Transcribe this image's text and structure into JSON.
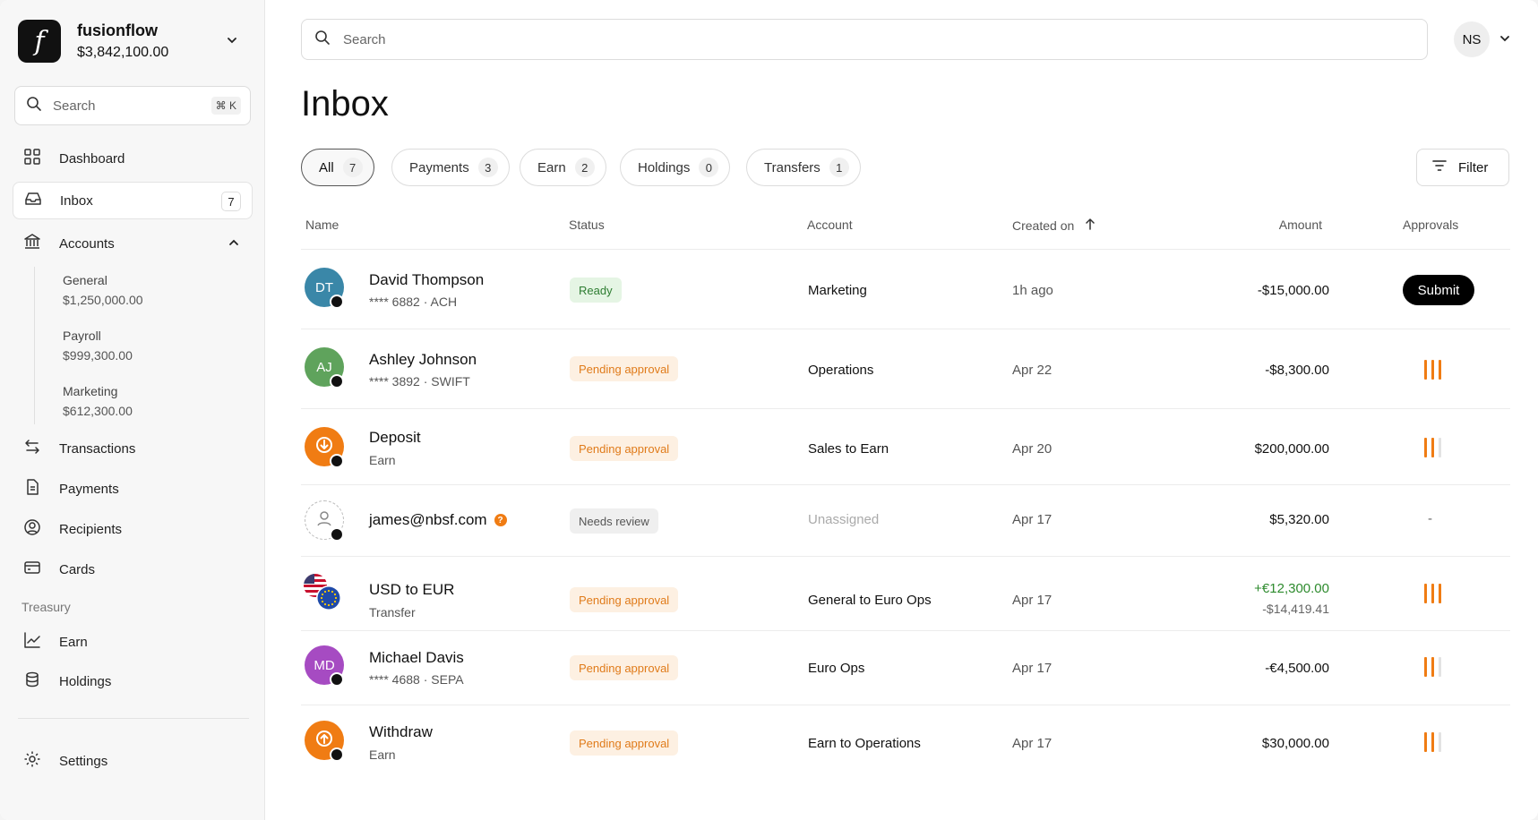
{
  "org": {
    "name": "fusionflow",
    "balance": "$3,842,100.00",
    "logo_letter": "f"
  },
  "sidebar": {
    "search_placeholder": "Search",
    "search_shortcut": "⌘ K",
    "nav": [
      {
        "label": "Dashboard",
        "icon": "grid-icon"
      },
      {
        "label": "Inbox",
        "icon": "inbox-icon",
        "count": "7",
        "active": true
      },
      {
        "label": "Accounts",
        "icon": "bank-icon",
        "expanded": true
      }
    ],
    "accounts": [
      {
        "name": "General",
        "balance": "$1,250,000.00"
      },
      {
        "name": "Payroll",
        "balance": "$999,300.00"
      },
      {
        "name": "Marketing",
        "balance": "$612,300.00"
      }
    ],
    "nav2": [
      {
        "label": "Transactions",
        "icon": "arrows-swap-icon"
      },
      {
        "label": "Payments",
        "icon": "document-icon"
      },
      {
        "label": "Recipients",
        "icon": "user-circle-icon"
      },
      {
        "label": "Cards",
        "icon": "credit-card-icon"
      }
    ],
    "treasury_label": "Treasury",
    "treasury": [
      {
        "label": "Earn",
        "icon": "chart-up-icon"
      },
      {
        "label": "Holdings",
        "icon": "database-icon"
      }
    ],
    "settings_label": "Settings"
  },
  "header": {
    "search_placeholder": "Search",
    "user_initials": "NS",
    "title": "Inbox"
  },
  "tabs": [
    {
      "label": "All",
      "count": "7",
      "active": true
    },
    {
      "label": "Payments",
      "count": "3"
    },
    {
      "label": "Earn",
      "count": "2"
    },
    {
      "label": "Holdings",
      "count": "0"
    },
    {
      "label": "Transfers",
      "count": "1"
    }
  ],
  "filter_label": "Filter",
  "columns": {
    "name": "Name",
    "status": "Status",
    "account": "Account",
    "created": "Created on",
    "amount": "Amount",
    "approvals": "Approvals"
  },
  "rows": [
    {
      "initials": "DT",
      "avatar_color": "#3a87a8",
      "name": "David Thompson",
      "detail": "**** 6882  ·  ACH",
      "status": "Ready",
      "account": "Marketing",
      "date": "1h ago",
      "amount": "-$15,000.00",
      "approval": "Submit"
    },
    {
      "initials": "AJ",
      "avatar_color": "#5fa35c",
      "name": "Ashley Johnson",
      "detail": "**** 3892  ·  SWIFT",
      "status": "Pending approval",
      "account": "Operations",
      "date": "Apr 22",
      "amount": "-$8,300.00",
      "approvals_done": 3,
      "approvals_total": 3
    },
    {
      "icon": "download-arrow-icon",
      "avatar_color": "#f07c13",
      "name": "Deposit",
      "detail": "Earn",
      "status": "Pending approval",
      "account": "Sales to Earn",
      "date": "Apr 20",
      "amount": "$200,000.00",
      "approvals_done": 2,
      "approvals_total": 3
    },
    {
      "icon": "person-outline-icon",
      "name": "james@nbsf.com",
      "status": "Needs review",
      "account": "Unassigned",
      "date": "Apr 17",
      "amount": "$5,320.00",
      "approval": "-"
    },
    {
      "icon": "flags-us-eu-icon",
      "name": "USD to EUR",
      "detail": "Transfer",
      "status": "Pending approval",
      "account": "General to Euro Ops",
      "date": "Apr 17",
      "amount": "+€12,300.00",
      "amount_sub": "-$14,419.41",
      "approvals_done": 3,
      "approvals_total": 3
    },
    {
      "initials": "MD",
      "avatar_color": "#a64bc2",
      "name": "Michael Davis",
      "detail": "**** 4688   ·   SEPA",
      "status": "Pending approval",
      "account": "Euro Ops",
      "date": "Apr 17",
      "amount": "-€4,500.00",
      "approvals_done": 2,
      "approvals_total": 3
    },
    {
      "icon": "upload-arrow-icon",
      "avatar_color": "#f07c13",
      "name": "Withdraw",
      "detail": "Earn",
      "status": "Pending approval",
      "account": "Earn to Operations",
      "date": "Apr 17",
      "amount": "$30,000.00",
      "approvals_done": 2,
      "approvals_total": 3
    }
  ],
  "colors": {
    "accent": "#f07c13",
    "ready": "#2e7d32",
    "positive": "#2e8b2e"
  }
}
